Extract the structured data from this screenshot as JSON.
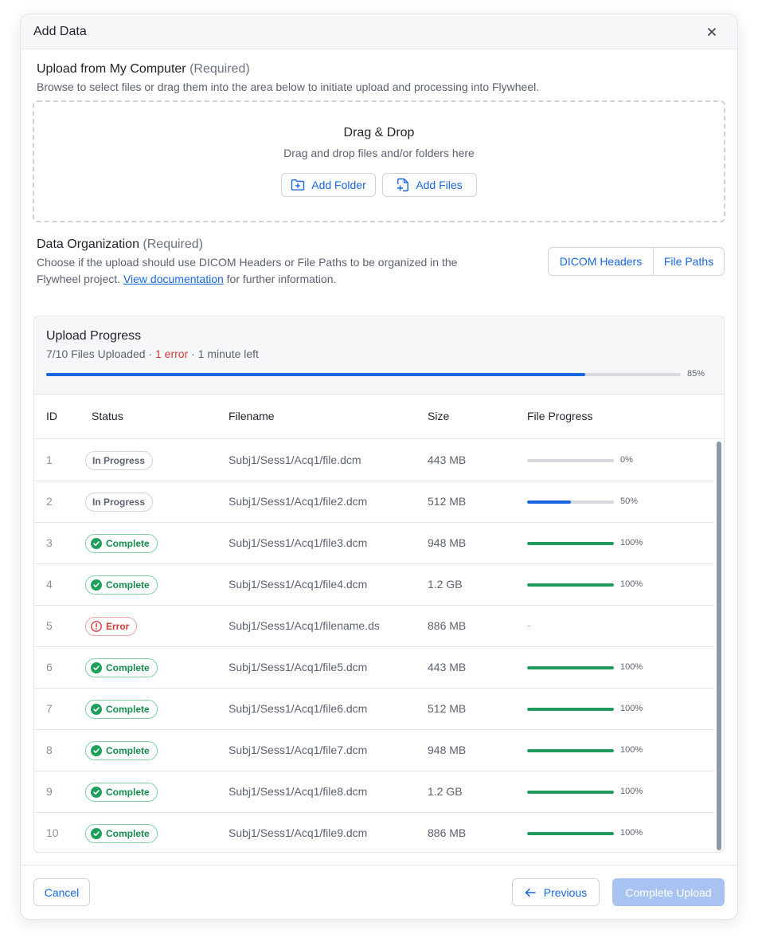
{
  "modal": {
    "title": "Add Data"
  },
  "upload_section": {
    "title": "Upload from My Computer",
    "required": "(Required)",
    "description": "Browse to select files or drag them into the area below to initiate upload and processing into Flywheel."
  },
  "dropzone": {
    "title": "Drag & Drop",
    "subtitle": "Drag and drop files and/or folders here",
    "add_folder_label": "Add Folder",
    "add_files_label": "Add Files"
  },
  "organization": {
    "title": "Data Organization",
    "required": "(Required)",
    "description_before": "Choose if the upload should use DICOM Headers or File Paths to be organized in the Flywheel project.",
    "link_text": "View documentation",
    "description_after": "for further information.",
    "options": [
      "DICOM Headers",
      "File Paths"
    ]
  },
  "progress": {
    "title": "Upload Progress",
    "files_uploaded": "7/10 Files Uploaded",
    "separator": "·",
    "errors": "1 error",
    "time_left": "1 minute left",
    "overall_percent": 85,
    "overall_percent_label": "85%"
  },
  "table": {
    "columns": {
      "id": "ID",
      "status": "Status",
      "filename": "Filename",
      "size": "Size",
      "progress": "File Progress"
    },
    "rows": [
      {
        "id": "1",
        "status": "In Progress",
        "status_type": "in-progress",
        "filename": "Subj1/Sess1/Acq1/file.dcm",
        "size": "443 MB",
        "progress": 0,
        "progress_label": "0%"
      },
      {
        "id": "2",
        "status": "In Progress",
        "status_type": "in-progress",
        "filename": "Subj1/Sess1/Acq1/file2.dcm",
        "size": "512 MB",
        "progress": 50,
        "progress_label": "50%"
      },
      {
        "id": "3",
        "status": "Complete",
        "status_type": "complete",
        "filename": "Subj1/Sess1/Acq1/file3.dcm",
        "size": "948 MB",
        "progress": 100,
        "progress_label": "100%"
      },
      {
        "id": "4",
        "status": "Complete",
        "status_type": "complete",
        "filename": "Subj1/Sess1/Acq1/file4.dcm",
        "size": "1.2 GB",
        "progress": 100,
        "progress_label": "100%"
      },
      {
        "id": "5",
        "status": "Error",
        "status_type": "error",
        "filename": "Subj1/Sess1/Acq1/filename.ds",
        "size": "886 MB",
        "progress": null,
        "progress_label": "-"
      },
      {
        "id": "6",
        "status": "Complete",
        "status_type": "complete",
        "filename": "Subj1/Sess1/Acq1/file5.dcm",
        "size": "443 MB",
        "progress": 100,
        "progress_label": "100%"
      },
      {
        "id": "7",
        "status": "Complete",
        "status_type": "complete",
        "filename": "Subj1/Sess1/Acq1/file6.dcm",
        "size": "512 MB",
        "progress": 100,
        "progress_label": "100%"
      },
      {
        "id": "8",
        "status": "Complete",
        "status_type": "complete",
        "filename": "Subj1/Sess1/Acq1/file7.dcm",
        "size": "948 MB",
        "progress": 100,
        "progress_label": "100%"
      },
      {
        "id": "9",
        "status": "Complete",
        "status_type": "complete",
        "filename": "Subj1/Sess1/Acq1/file8.dcm",
        "size": "1.2 GB",
        "progress": 100,
        "progress_label": "100%"
      },
      {
        "id": "10",
        "status": "Complete",
        "status_type": "complete",
        "filename": "Subj1/Sess1/Acq1/file9.dcm",
        "size": "886 MB",
        "progress": 100,
        "progress_label": "100%"
      }
    ]
  },
  "footer": {
    "cancel_label": "Cancel",
    "previous_label": "Previous",
    "complete_label": "Complete Upload"
  },
  "colors": {
    "accent": "#1a66e0",
    "success": "#1f9d5a",
    "error": "#d63a3a",
    "track": "#d7dadf"
  },
  "icons": {
    "close": "close-icon",
    "add_folder": "folder-plus-icon",
    "add_files": "file-plus-icon",
    "complete": "check-circle-icon",
    "error": "alert-circle-icon",
    "previous": "arrow-left-icon"
  }
}
